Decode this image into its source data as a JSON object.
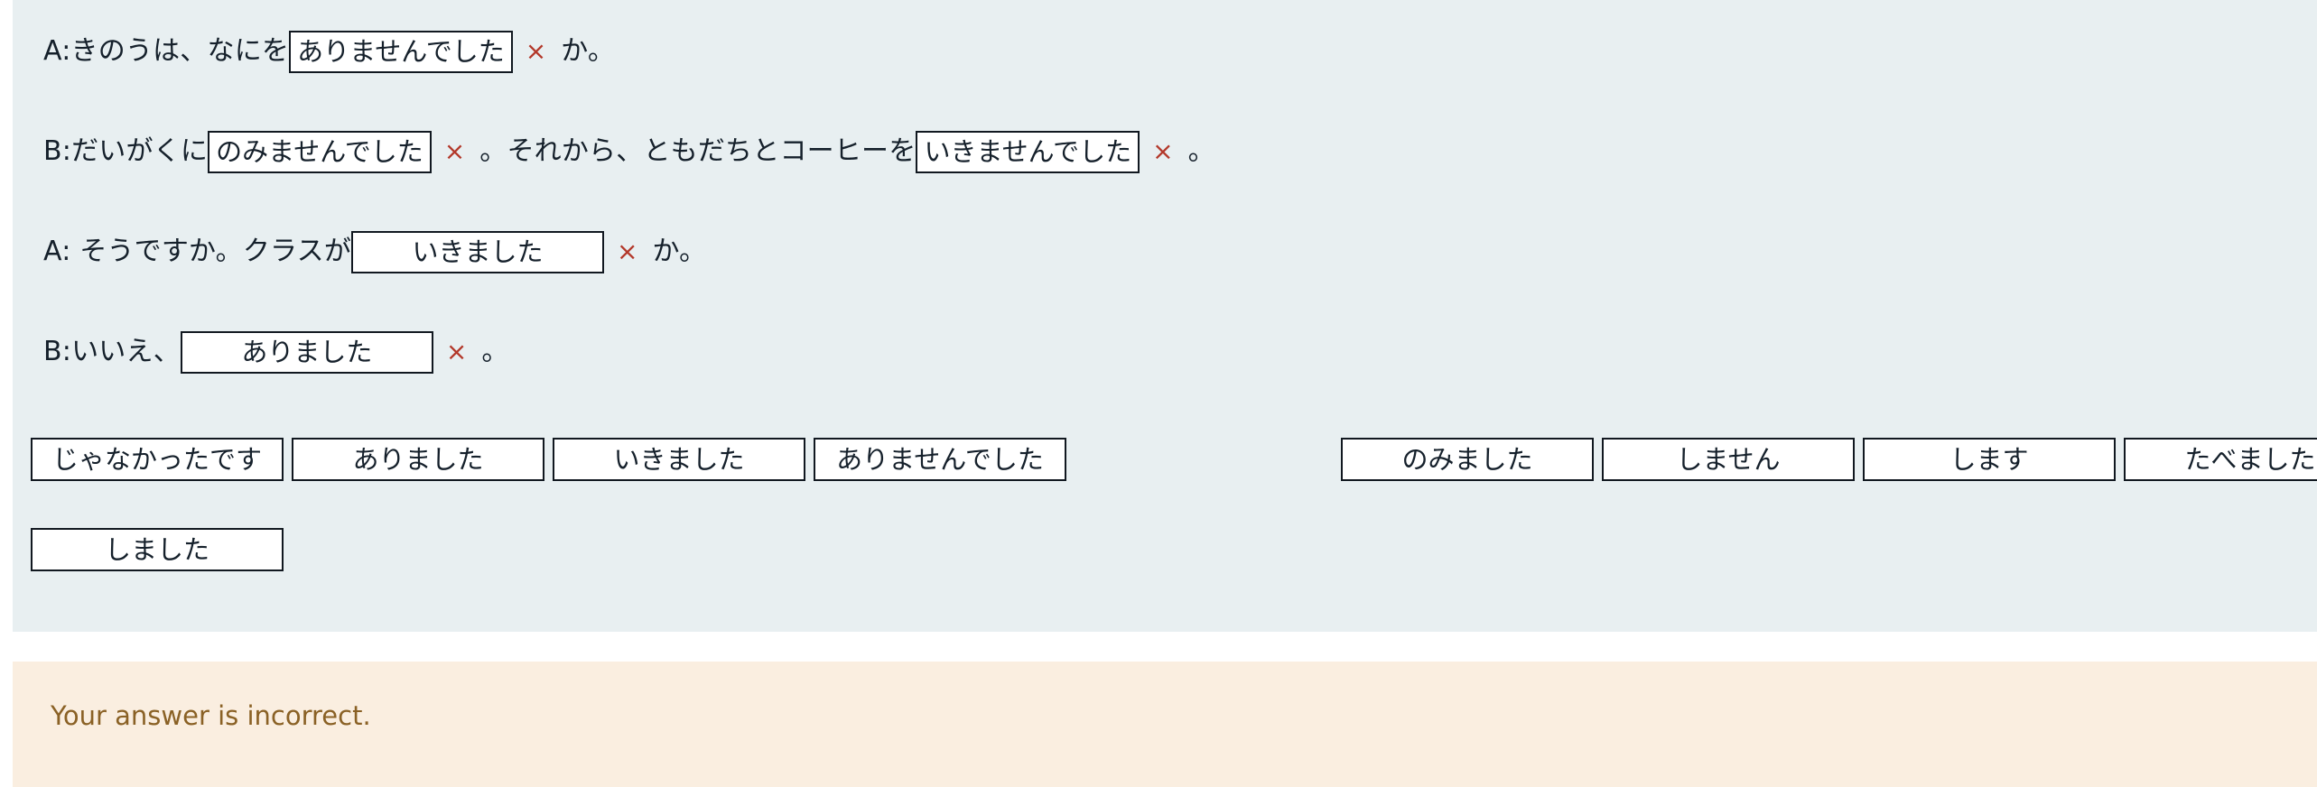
{
  "colors": {
    "panel_bg": "#e8eff1",
    "page_bg": "#ffffff",
    "box_border": "#111820",
    "box_fill": "#ffffff",
    "text": "#15202b",
    "incorrect_mark": "#b3382a",
    "feedback_bg": "#faeee0",
    "feedback_text": "#8a6125"
  },
  "exercise": {
    "dialogue": [
      {
        "speaker_prefix": "A:",
        "segments": [
          {
            "kind": "text",
            "value": "A:きのうは、なにを"
          },
          {
            "kind": "blank",
            "value": "ありませんでした",
            "width": "auto",
            "result": "incorrect"
          },
          {
            "kind": "mark",
            "value": "×"
          },
          {
            "kind": "text",
            "value": "か。"
          }
        ]
      },
      {
        "speaker_prefix": "B:",
        "segments": [
          {
            "kind": "text",
            "value": "B:だいがくに"
          },
          {
            "kind": "blank",
            "value": "のみませんでした",
            "width": "auto",
            "result": "incorrect"
          },
          {
            "kind": "mark",
            "value": "×"
          },
          {
            "kind": "text",
            "value": "。それから、ともだちとコーヒーを"
          },
          {
            "kind": "blank",
            "value": "いきませんでした",
            "width": "auto",
            "result": "incorrect"
          },
          {
            "kind": "mark",
            "value": "×"
          },
          {
            "kind": "text",
            "value": "。"
          }
        ]
      },
      {
        "speaker_prefix": "A:",
        "segments": [
          {
            "kind": "text",
            "value": "A: そうですか。クラスが"
          },
          {
            "kind": "blank",
            "value": "いきました",
            "width": "fixed",
            "result": "incorrect"
          },
          {
            "kind": "mark",
            "value": "×"
          },
          {
            "kind": "text",
            "value": "か。"
          }
        ]
      },
      {
        "speaker_prefix": "B:",
        "segments": [
          {
            "kind": "text",
            "value": "B:いいえ、"
          },
          {
            "kind": "blank",
            "value": "ありました",
            "width": "fixed",
            "result": "incorrect"
          },
          {
            "kind": "mark",
            "value": "×"
          },
          {
            "kind": "text",
            "value": "。"
          }
        ]
      }
    ],
    "word_bank": {
      "row1_left": [
        {
          "label": "じゃなかったです"
        },
        {
          "label": "ありました"
        },
        {
          "label": "いきました"
        },
        {
          "label": "ありませんでした"
        }
      ],
      "row1_right": [
        {
          "label": "のみました"
        },
        {
          "label": "しません"
        },
        {
          "label": "します"
        },
        {
          "label": "たべました"
        }
      ],
      "row2": [
        {
          "label": "しました"
        }
      ]
    }
  },
  "feedback": {
    "message": "Your answer is incorrect."
  }
}
